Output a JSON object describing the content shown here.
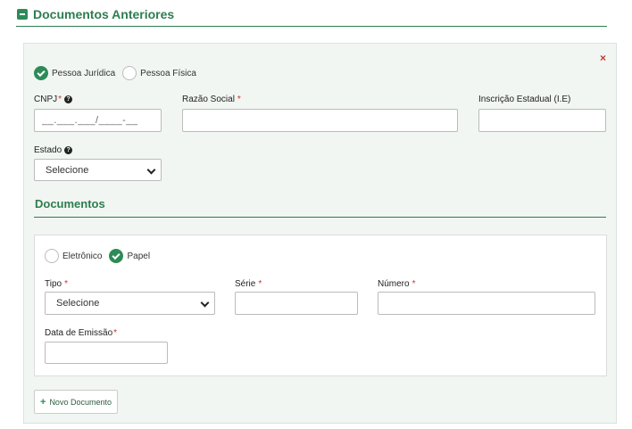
{
  "section": {
    "title": "Documentos Anteriores"
  },
  "form": {
    "close_label": "×",
    "person_type": {
      "options": [
        "Pessoa Jurídica",
        "Pessoa Física"
      ],
      "selected": "Pessoa Jurídica"
    },
    "cnpj": {
      "label": "CNPJ",
      "required_mark": "*",
      "help": "?",
      "placeholder": "__.___.___/____-__",
      "value": ""
    },
    "razao_social": {
      "label": "Razão Social",
      "required_mark": "*",
      "value": ""
    },
    "inscricao": {
      "label": "Inscrição Estadual (I.E)",
      "value": ""
    },
    "estado": {
      "label": "Estado",
      "help": "?",
      "selected": "Selecione"
    }
  },
  "documents": {
    "title": "Documentos",
    "doc_type": {
      "options": [
        "Eletrônico",
        "Papel"
      ],
      "selected": "Papel"
    },
    "tipo": {
      "label": "Tipo",
      "required_mark": "*",
      "selected": "Selecione"
    },
    "serie": {
      "label": "Série",
      "required_mark": "*",
      "value": ""
    },
    "numero": {
      "label": "Número",
      "required_mark": "*",
      "value": ""
    },
    "data_emissao": {
      "label": "Data de Emissão",
      "required_mark": "*",
      "value": ""
    },
    "add_button": {
      "icon": "+",
      "label": "Novo Documento"
    }
  },
  "colors": {
    "accent": "#2e7d4f",
    "required": "#c0392b",
    "panel_bg": "#f1f6f2"
  }
}
